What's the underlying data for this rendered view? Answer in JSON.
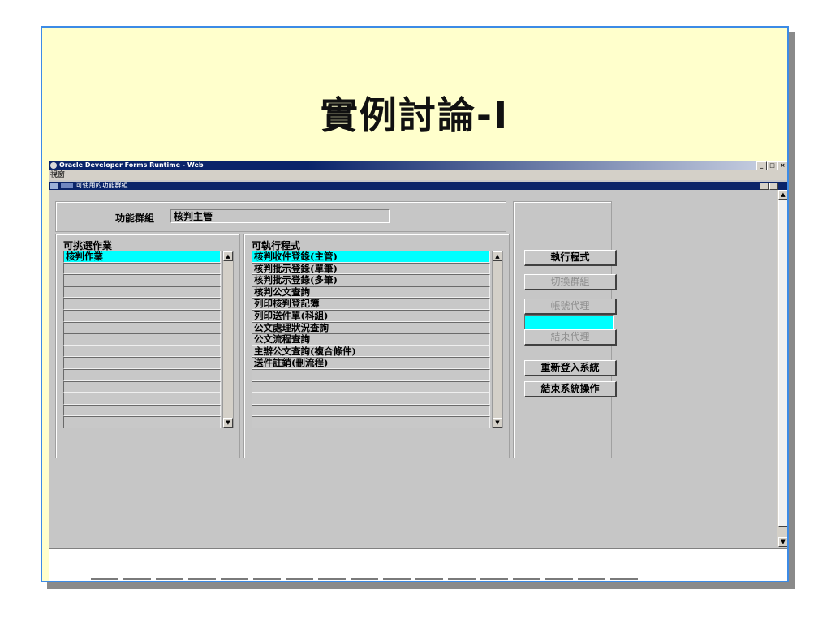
{
  "slide": {
    "title": "實例討論-I"
  },
  "app": {
    "title": "Oracle Developer Forms Runtime - Web",
    "menu": "視窗",
    "window_controls": [
      "_",
      "□",
      "×"
    ],
    "inner_window_title": "可使用的功能群組"
  },
  "form": {
    "group_label": "功能群組",
    "group_value": "核判主管",
    "ops_header": "可挑選作業",
    "ops_items": [
      "核判作業",
      "",
      "",
      "",
      "",
      "",
      "",
      "",
      "",
      "",
      "",
      "",
      "",
      "",
      ""
    ],
    "progs_header": "可執行程式",
    "progs_items": [
      "核判收件登錄(主管)",
      "核判批示登錄(單筆)",
      "核判批示登錄(多筆)",
      "核判公文查詢",
      "列印核判登記簿",
      "列印送件單(科組)",
      "公文處理狀況查詢",
      "公文流程查詢",
      "主辦公文查詢(複合條件)",
      "送件註銷(刪流程)",
      "",
      "",
      "",
      "",
      ""
    ],
    "buttons": {
      "run": "執行程式",
      "switch_group": "切換群組",
      "proxy": "帳號代理",
      "end_proxy": "結束代理",
      "relogin": "重新登入系統",
      "exit": "結束系統操作"
    }
  },
  "colors": {
    "selection": "#00ffff",
    "slide_bg": "#ffffcc",
    "titlebar": "#0a246a"
  },
  "icons": [
    "app-icon",
    "scroll-up-icon",
    "scroll-down-icon"
  ]
}
